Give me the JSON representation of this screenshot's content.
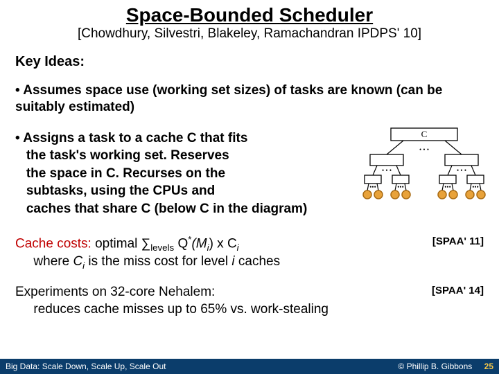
{
  "title": "Space-Bounded Scheduler",
  "citation": "[Chowdhury, Silvestri, Blakeley, Ramachandran IPDPS' 10]",
  "key_ideas_label": "Key Ideas:",
  "bullet1": "• Assumes space use (working set sizes) of tasks are known (can be suitably estimated)",
  "bullet2_line1": "• Assigns a task to a cache C that fits",
  "bullet2_line2": "the task's working set.  Reserves",
  "bullet2_line3": "the space in C.  Recurses on the",
  "bullet2_line4": "subtasks, using the CPUs and",
  "bullet2_line5": "caches that share C (below C in the diagram)",
  "diagram_label": "C",
  "cache_costs": {
    "label": "Cache costs:",
    "formula_prefix": "  optimal ∑",
    "formula_sub": "levels",
    "formula_mid1": " Q",
    "formula_sup": "*",
    "formula_mid2": "(M",
    "formula_sub2": "i",
    "formula_mid3": ") x C",
    "formula_sub3": "i",
    "line2_prefix": "where ",
    "line2_ci": "C",
    "line2_ci_sub": "i",
    "line2_mid": " is the miss cost for level ",
    "line2_i": "i",
    "line2_suffix": " caches",
    "ref": "[SPAA' 11]"
  },
  "experiments": {
    "line1": "Experiments on 32-core Nehalem:",
    "line2": "reduces cache misses up to 65% vs. work-stealing",
    "ref": "[SPAA' 14]"
  },
  "footer": {
    "left": "Big Data: Scale Down, Scale Up, Scale Out",
    "right": "© Phillip B. Gibbons",
    "slidenum": "25"
  }
}
